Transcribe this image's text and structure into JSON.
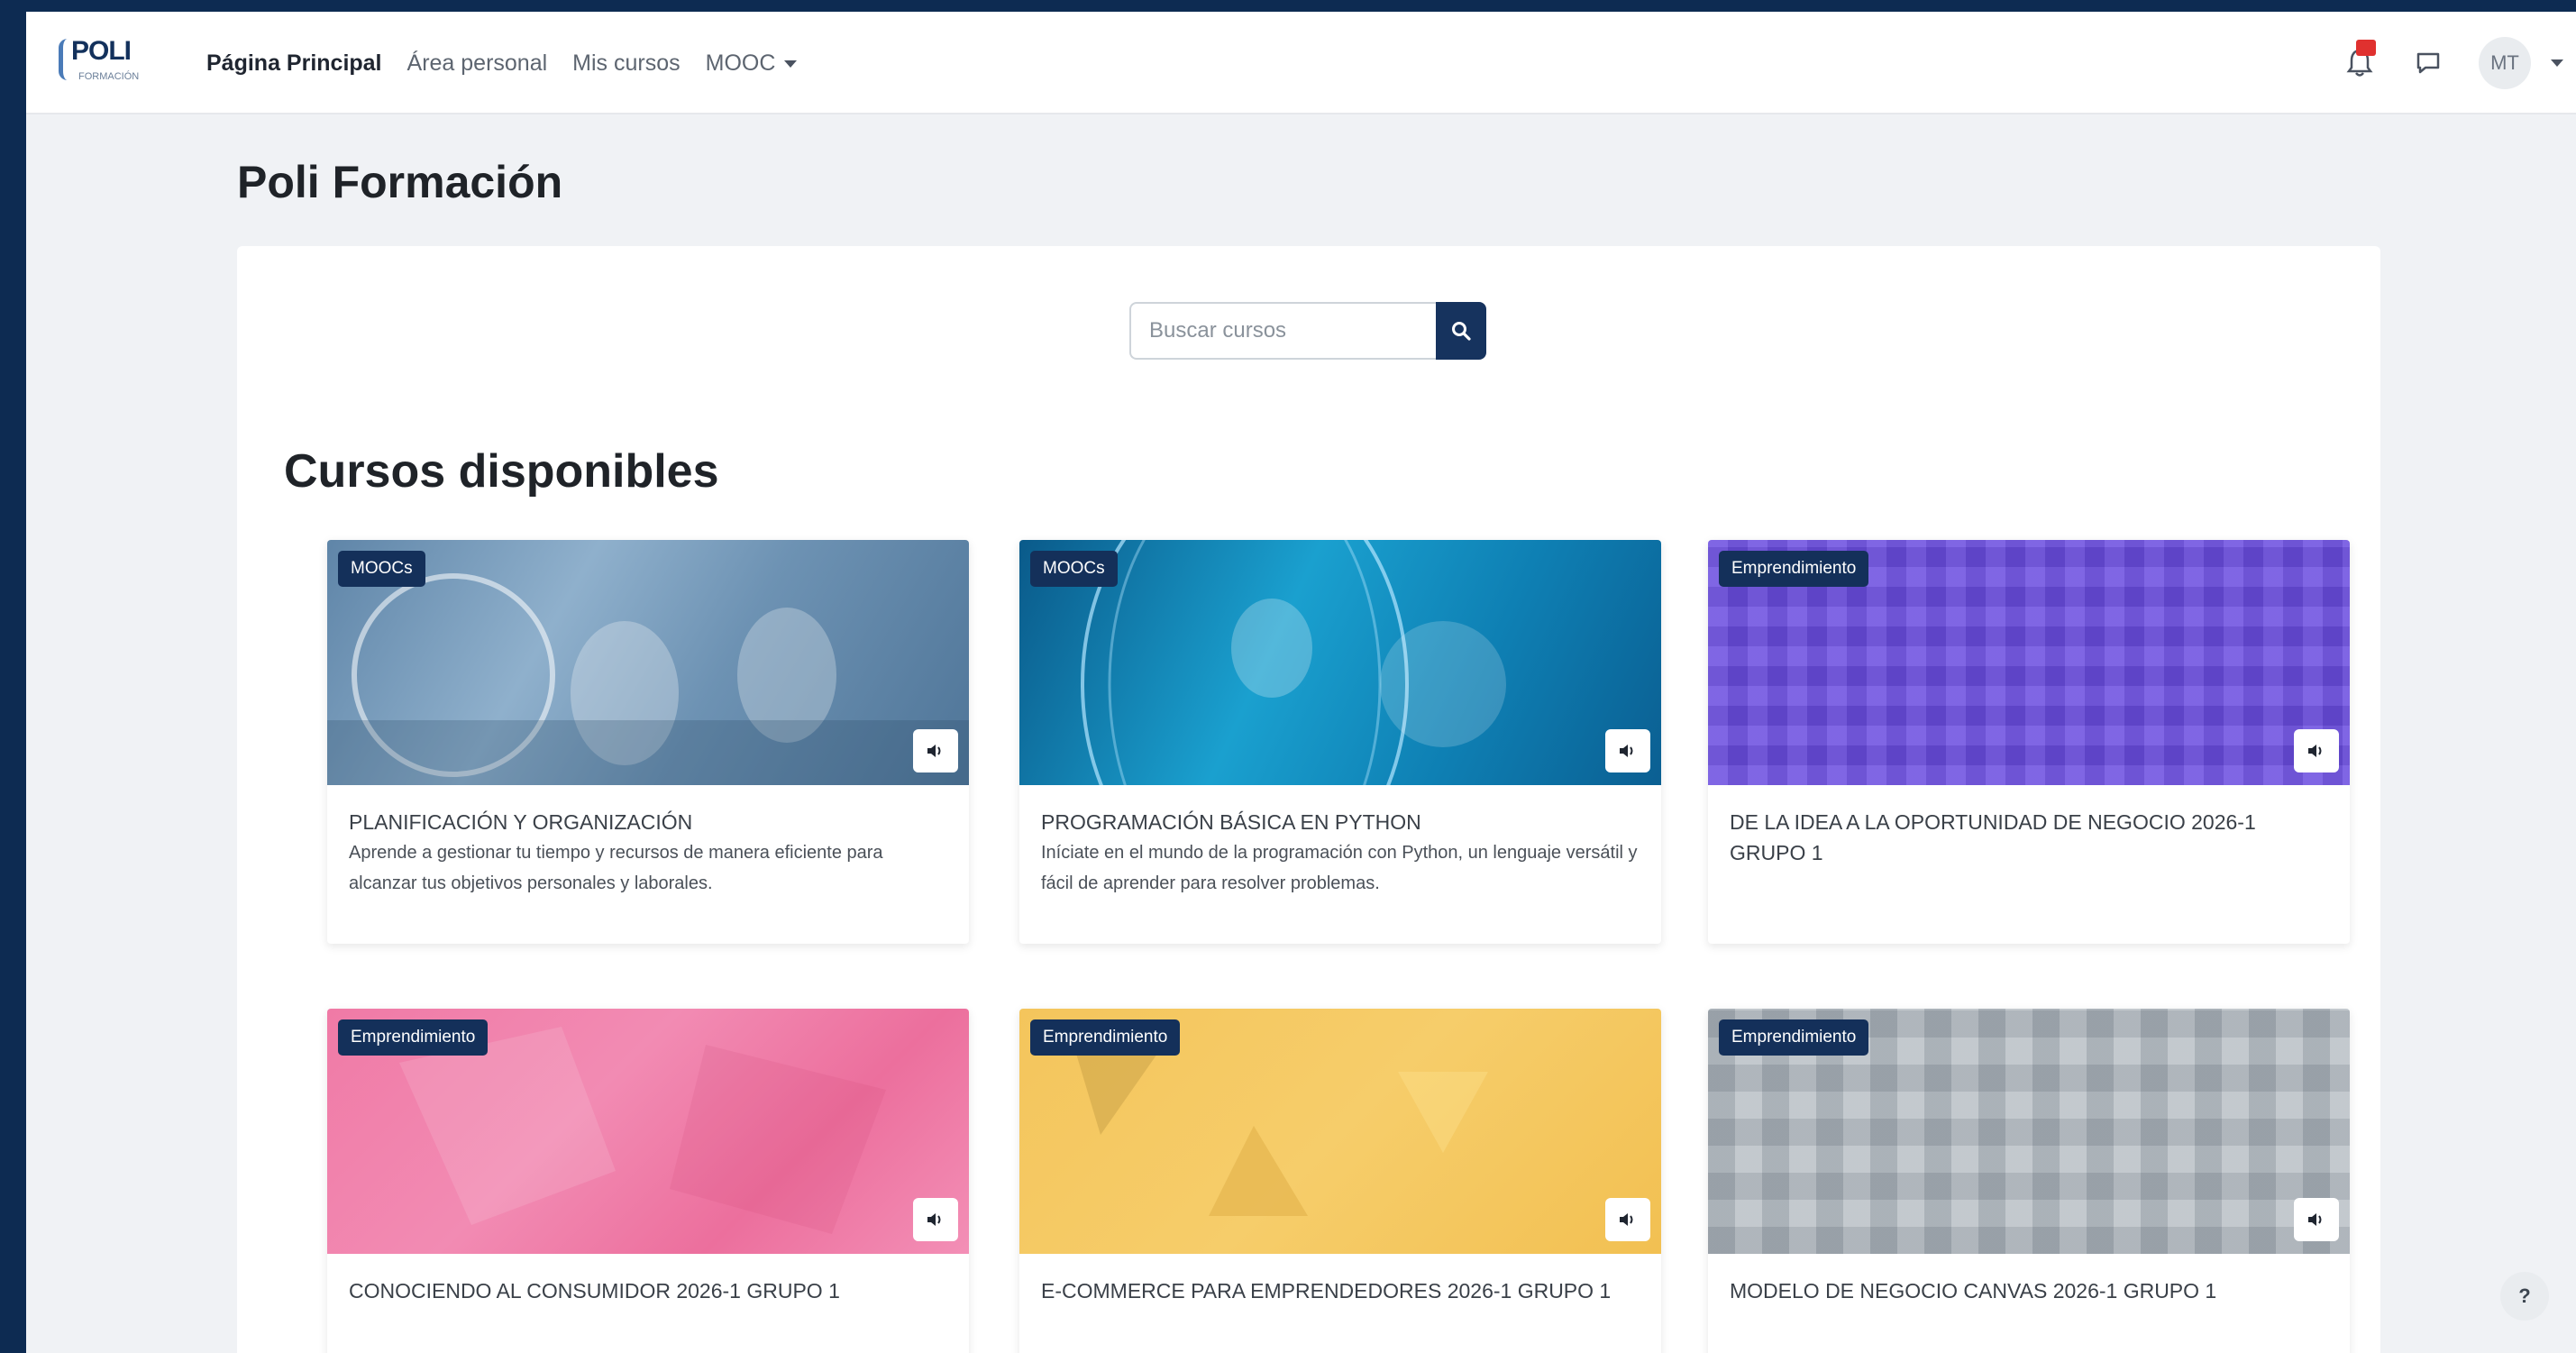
{
  "brand": {
    "logo_text": "POLI",
    "logo_sub": "FORMACIÓN"
  },
  "nav": {
    "home": "Página Principal",
    "dashboard": "Área personal",
    "my_courses": "Mis cursos",
    "mooc": "MOOC"
  },
  "header": {
    "notification_count": "",
    "user_initials": "MT"
  },
  "page": {
    "title": "Poli Formación"
  },
  "search": {
    "placeholder": "Buscar cursos"
  },
  "section": {
    "title": "Cursos disponibles"
  },
  "courses": [
    {
      "tag": "MOOCs",
      "title": "PLANIFICACIÓN Y ORGANIZACIÓN",
      "description": "Aprende a gestionar tu tiempo y recursos de manera eficiente para alcanzar tus objetivos personales y laborales."
    },
    {
      "tag": "MOOCs",
      "title": "PROGRAMACIÓN BÁSICA EN PYTHON",
      "description": "Iníciate en el mundo de la programación con Python, un lenguaje versátil y fácil de aprender para resolver problemas."
    },
    {
      "tag": "Emprendimiento",
      "title": "DE LA IDEA A LA OPORTUNIDAD DE NEGOCIO 2026-1 GRUPO 1",
      "description": ""
    },
    {
      "tag": "Emprendimiento",
      "title": "CONOCIENDO AL CONSUMIDOR 2026-1 GRUPO 1",
      "description": ""
    },
    {
      "tag": "Emprendimiento",
      "title": "E-COMMERCE PARA EMPRENDEDORES 2026-1 GRUPO 1",
      "description": ""
    },
    {
      "tag": "Emprendimiento",
      "title": "MODELO DE NEGOCIO CANVAS 2026-1 GRUPO 1",
      "description": ""
    }
  ],
  "help": {
    "label": "?"
  },
  "colors": {
    "navy": "#16335e",
    "background": "#f0f2f5",
    "badge_red": "#e0312f"
  },
  "icons": {
    "search": "search-icon",
    "bell": "bell-icon",
    "chat": "chat-icon",
    "audio": "speaker-icon"
  }
}
